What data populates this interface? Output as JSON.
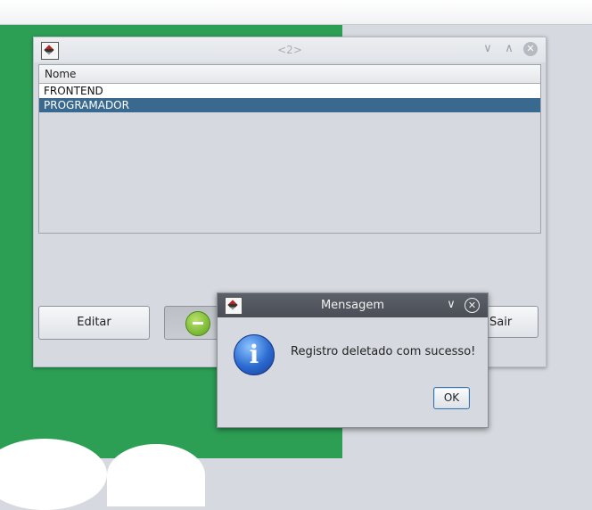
{
  "background": {
    "brand_color": "#2c9f55"
  },
  "main_window": {
    "title": "<2>",
    "icon": "java-app-icon",
    "controls": {
      "minimize": "∨",
      "maximize": "∧",
      "close": "✕"
    },
    "table": {
      "columns": [
        "Nome"
      ],
      "rows": [
        {
          "nome": "FRONTEND",
          "selected": false
        },
        {
          "nome": "PROGRAMADOR",
          "selected": true
        }
      ]
    },
    "buttons": {
      "edit": "Editar",
      "delete_icon": "minus-icon",
      "exit": "Sair"
    }
  },
  "dialog": {
    "title": "Mensagem",
    "icon": "info-icon",
    "message": "Registro deletado com sucesso!",
    "ok": "OK",
    "controls": {
      "minimize": "∨",
      "close": "✕"
    },
    "info_glyph": "i"
  }
}
